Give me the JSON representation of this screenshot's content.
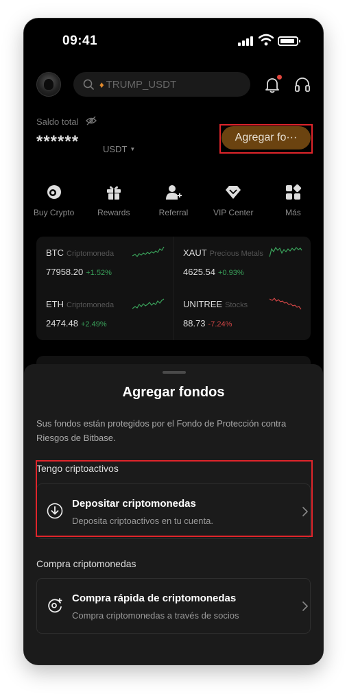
{
  "status_bar": {
    "time": "09:41"
  },
  "header": {
    "search_placeholder": "TRUMP_USDT"
  },
  "balance": {
    "label": "Saldo total",
    "masked_value": "******",
    "currency": "USDT",
    "add_funds_label": "Agregar fo···"
  },
  "quick_actions": [
    {
      "label": "Buy Crypto",
      "icon": "coin-icon"
    },
    {
      "label": "Rewards",
      "icon": "gift-icon"
    },
    {
      "label": "Referral",
      "icon": "add-user-icon"
    },
    {
      "label": "VIP Center",
      "icon": "diamond-icon"
    },
    {
      "label": "Más",
      "icon": "more-grid-icon"
    }
  ],
  "markets": [
    {
      "symbol": "BTC",
      "category": "Criptomoneda",
      "price": "77958.20",
      "change": "+1.52%",
      "trend": "up"
    },
    {
      "symbol": "XAUT",
      "category": "Precious Metals",
      "price": "4625.54",
      "change": "+0.93%",
      "trend": "up"
    },
    {
      "symbol": "ETH",
      "category": "Criptomoneda",
      "price": "2474.48",
      "change": "+2.49%",
      "trend": "up"
    },
    {
      "symbol": "UNITREE",
      "category": "Stocks",
      "price": "88.73",
      "change": "-7.24%",
      "trend": "down"
    }
  ],
  "sheet": {
    "title": "Agregar fondos",
    "description": "Sus fondos están protegidos por el Fondo de Protección contra Riesgos de Bitbase.",
    "section1_label": "Tengo criptoactivos",
    "deposit_title": "Depositar criptomonedas",
    "deposit_subtitle": "Deposita criptoactivos en tu cuenta.",
    "section2_label": "Compra criptomonedas",
    "quickbuy_title": "Compra rápida de criptomonedas",
    "quickbuy_subtitle": "Compra criptomonedas a través de socios"
  },
  "colors": {
    "up": "#3aa35b",
    "down": "#d24646",
    "accent_button": "#6b4310",
    "highlight": "#e0252b"
  }
}
